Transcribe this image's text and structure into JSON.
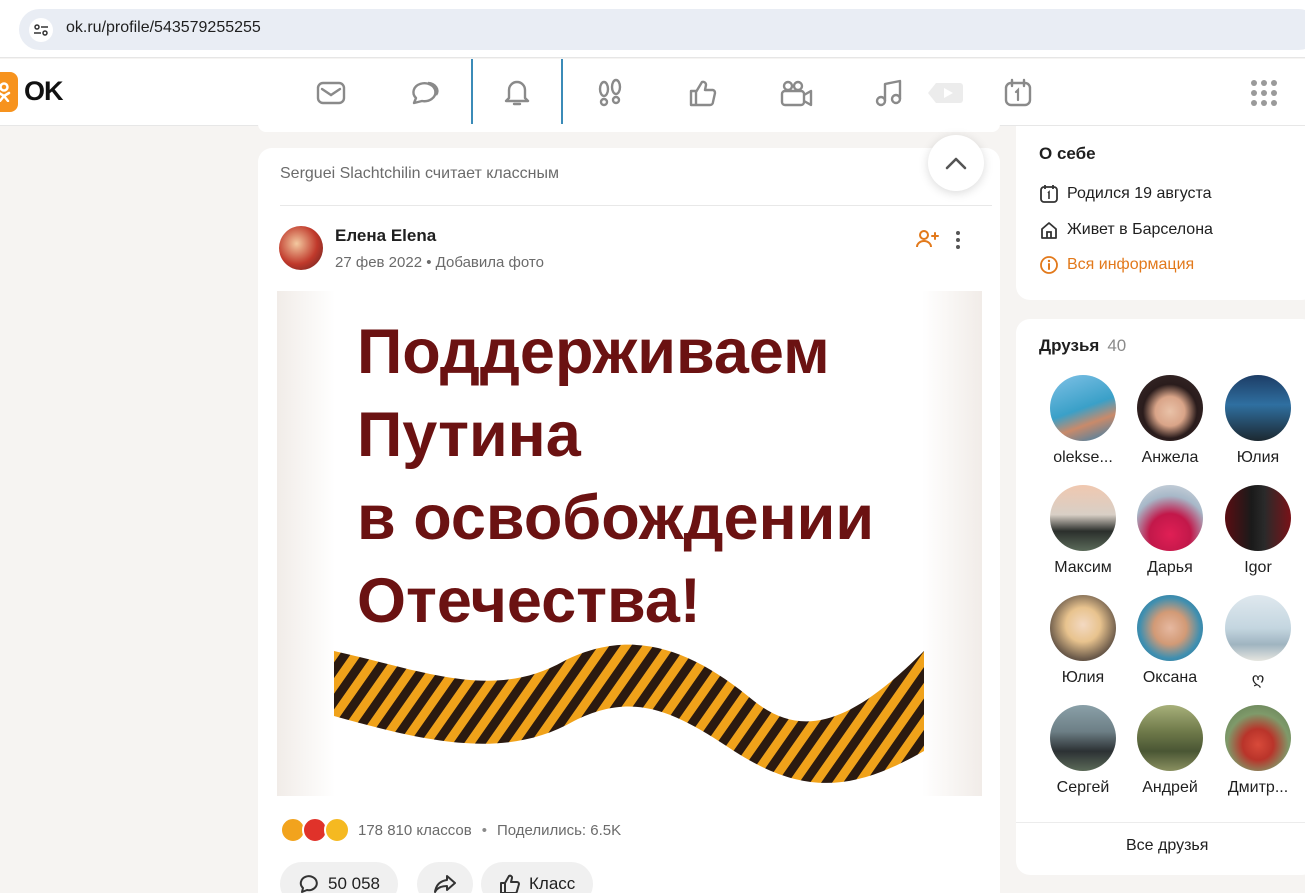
{
  "browser": {
    "url": "ok.ru/profile/543579255255"
  },
  "nav": {
    "logo_text": "OK",
    "items": [
      {
        "icon": "mail-icon"
      },
      {
        "icon": "chat-icon"
      },
      {
        "icon": "bell-icon",
        "active": true
      },
      {
        "icon": "footprints-icon"
      },
      {
        "icon": "thumbs-up-icon"
      },
      {
        "icon": "video-camera-icon"
      },
      {
        "icon": "music-icon"
      },
      {
        "icon": "play-icon"
      },
      {
        "icon": "calendar-icon"
      }
    ],
    "accent_color": "#3b8bb8"
  },
  "feed": {
    "liked_by": "Serguei Slachtchilin считает классным",
    "post": {
      "author": "Елена Elena",
      "date": "27 фев 2022",
      "separator": "•",
      "action": "Добавила фото",
      "photo_lines": [
        "Поддерживаем",
        "Путина",
        "в освобождении",
        "Отечества!"
      ],
      "classes_text": "178 810 классов",
      "shares_text": "Поделились: 6.5K",
      "comments_count": "50 058",
      "class_label": "Класс"
    }
  },
  "about": {
    "title": "О себе",
    "born": "Родился 19 августа",
    "lives": "Живет в Барселона",
    "all_info": "Вся информация",
    "accent_color": "#e2791b"
  },
  "friends": {
    "title": "Друзья",
    "count": "40",
    "items": [
      {
        "name": "olekse..."
      },
      {
        "name": "Анжела"
      },
      {
        "name": "Юлия"
      },
      {
        "name": "Максим"
      },
      {
        "name": "Дарья"
      },
      {
        "name": "Igor"
      },
      {
        "name": "Юлия"
      },
      {
        "name": "Оксана"
      },
      {
        "name": "ღ"
      },
      {
        "name": "Сергей"
      },
      {
        "name": "Андрей"
      },
      {
        "name": "Дмитр..."
      }
    ],
    "all_label": "Все друзья"
  }
}
